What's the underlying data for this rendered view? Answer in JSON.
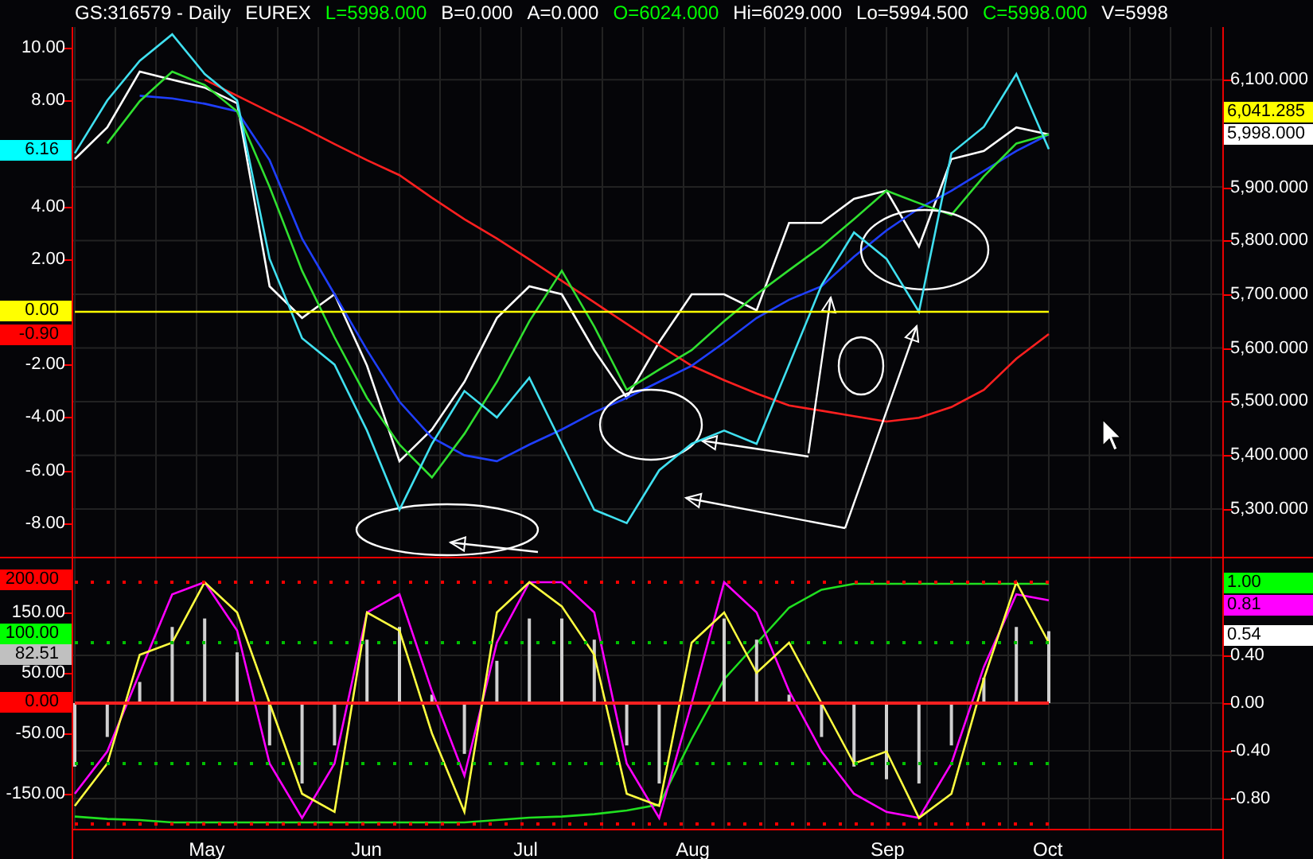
{
  "header": [
    {
      "text": "GS:316579 - Daily",
      "color": "#ffffff"
    },
    {
      "text": "EUREX",
      "color": "#ffffff"
    },
    {
      "text": "L=5998.000",
      "color": "#00ff00"
    },
    {
      "text": "B=0.000",
      "color": "#ffffff"
    },
    {
      "text": "A=0.000",
      "color": "#ffffff"
    },
    {
      "text": "O=6024.000",
      "color": "#00ff00"
    },
    {
      "text": "Hi=6029.000",
      "color": "#ffffff"
    },
    {
      "text": "Lo=5994.500",
      "color": "#ffffff"
    },
    {
      "text": "C=5998.000",
      "color": "#00ff00"
    },
    {
      "text": "V=5998",
      "color": "#ffffff"
    }
  ],
  "main_panel": {
    "price_chart": {
      "chart_data": {
        "type": "line",
        "grid": true,
        "categories": [
          null,
          null,
          null,
          null,
          null,
          null,
          null,
          null,
          null,
          null,
          null,
          null,
          null,
          null,
          null,
          null,
          null,
          null,
          null,
          null,
          null,
          null,
          null,
          null,
          null,
          null,
          null,
          null,
          null,
          null,
          null
        ],
        "ylim": [
          5211,
          6198
        ],
        "yticks": [
          {
            "value": 6100,
            "label": "6,100.000"
          },
          {
            "value": 5900,
            "label": "5,900.000"
          },
          {
            "value": 5800,
            "label": "5,800.000"
          },
          {
            "value": 5700,
            "label": "5,700.000"
          },
          {
            "value": 5600,
            "label": "5,600.000"
          },
          {
            "value": 5500,
            "label": "5,500.000"
          },
          {
            "value": 5400,
            "label": "5,400.000"
          },
          {
            "value": 5300,
            "label": "5,300.000"
          }
        ],
        "series": [
          {
            "color": "#ffffff",
            "values": [
              5952,
              6011,
              6115,
              6100,
              6085,
              6056,
              5715,
              5656,
              5700,
              5567,
              5389,
              5448,
              5537,
              5656,
              5715,
              5700,
              5596,
              5507,
              5611,
              5700,
              5700,
              5670,
              5833,
              5833,
              5878,
              5893,
              5789,
              5952,
              5967,
              6011,
              5998
            ]
          },
          {
            "color": "#ff2020",
            "values": [
              null,
              null,
              null,
              null,
              6100,
              6070,
              6040,
              6011,
              5980,
              5950,
              5922,
              5880,
              5840,
              5804,
              5765,
              5725,
              5685,
              5645,
              5605,
              5567,
              5540,
              5515,
              5493,
              5483,
              5473,
              5463,
              5470,
              5490,
              5522,
              5580,
              5626
            ]
          },
          {
            "color": "#1f3fff",
            "values": [
              null,
              null,
              6070,
              6065,
              6055,
              6041,
              5950,
              5804,
              5700,
              5596,
              5500,
              5433,
              5400,
              5389,
              5420,
              5448,
              5480,
              5507,
              5537,
              5567,
              5610,
              5656,
              5690,
              5715,
              5770,
              5819,
              5860,
              5893,
              5930,
              5967,
              5998
            ]
          },
          {
            "color": "#30e030",
            "values": [
              null,
              5981,
              6060,
              6115,
              6090,
              6041,
              5900,
              5744,
              5620,
              5507,
              5420,
              5359,
              5440,
              5537,
              5650,
              5744,
              5640,
              5522,
              5560,
              5596,
              5650,
              5700,
              5745,
              5789,
              5840,
              5893,
              5870,
              5848,
              5920,
              5981,
              5998
            ]
          }
        ]
      }
    },
    "oscillator_chart": {
      "chart_data": {
        "type": "line",
        "categories": [
          null,
          null,
          null,
          null,
          null,
          null,
          null,
          null,
          null,
          null,
          null,
          null,
          null,
          null,
          null,
          null,
          null,
          null,
          null,
          null,
          null,
          null,
          null,
          null,
          null,
          null,
          null,
          null,
          null,
          null,
          null
        ],
        "ylim": [
          -9.28,
          10.78
        ],
        "yticks": [
          {
            "value": 10,
            "label": "10.00"
          },
          {
            "value": 8,
            "label": "8.00"
          },
          {
            "value": 4,
            "label": "4.00"
          },
          {
            "value": 2,
            "label": "2.00"
          },
          {
            "value": -2,
            "label": "-2.00"
          },
          {
            "value": -4,
            "label": "-4.00"
          },
          {
            "value": -6,
            "label": "-6.00"
          },
          {
            "value": -8,
            "label": "-8.00"
          }
        ],
        "series": [
          {
            "color": "#40e0f0",
            "values": [
              6,
              8,
              9.5,
              10.5,
              9,
              8,
              2,
              -1,
              -2,
              -4.5,
              -7.5,
              -5,
              -3,
              -4,
              -2.5,
              -5,
              -7.5,
              -8,
              -6,
              -5,
              -4.5,
              -5,
              -2,
              1,
              3,
              2,
              0,
              6,
              7,
              9,
              6.16
            ]
          },
          {
            "color": "#ffff00",
            "values": [
              0,
              0,
              0,
              0,
              0,
              0,
              0,
              0,
              0,
              0,
              0,
              0,
              0,
              0,
              0,
              0,
              0,
              0,
              0,
              0,
              0,
              0,
              0,
              0,
              0,
              0,
              0,
              0,
              0,
              0,
              0
            ]
          }
        ]
      }
    },
    "left_tags": [
      {
        "text": "6.16",
        "color": "#00ffff"
      },
      {
        "text": "0.00",
        "color": "#ffff00"
      },
      {
        "text": "-0.90",
        "color": "#ff0000"
      }
    ],
    "right_tags": [
      {
        "text": "6,041.285",
        "color": "#ffff00"
      },
      {
        "text": "5,998.000",
        "color": "#ffffff"
      }
    ]
  },
  "lower_panel": {
    "trend_chart": {
      "chart_data": {
        "type": "line",
        "grid": true,
        "categories": [
          null,
          null,
          null,
          null,
          null,
          null,
          null,
          null,
          null,
          null,
          null,
          null,
          null,
          null,
          null,
          null,
          null,
          null,
          null,
          null,
          null,
          null,
          null,
          null,
          null,
          null,
          null,
          null,
          null,
          null,
          null
        ],
        "ylim": [
          -1.053,
          1.213
        ],
        "yticks": [
          {
            "value": 0.4,
            "label": "0.40"
          },
          {
            "value": 0,
            "label": "0.00"
          },
          {
            "value": -0.4,
            "label": "-0.40"
          },
          {
            "value": -0.8,
            "label": "-0.80"
          }
        ],
        "series": [
          {
            "color": "#20e020",
            "values": [
              -0.95,
              -0.97,
              -0.98,
              -1,
              -1,
              -1,
              -1,
              -1,
              -1,
              -1,
              -1,
              -1,
              -1,
              -0.98,
              -0.96,
              -0.95,
              -0.93,
              -0.9,
              -0.85,
              -0.3,
              0.2,
              0.5,
              0.8,
              0.95,
              1,
              1,
              1,
              1,
              1,
              1,
              1
            ]
          }
        ]
      }
    },
    "stochastic_chart": {
      "chart_data": {
        "type": "line",
        "categories": [
          null,
          null,
          null,
          null,
          "May",
          null,
          null,
          null,
          null,
          "Jun",
          null,
          null,
          null,
          null,
          "Jul",
          null,
          null,
          null,
          null,
          "Aug",
          null,
          null,
          null,
          null,
          null,
          "Sep",
          null,
          null,
          null,
          null,
          "Oct"
        ],
        "ylim": [
          -207.9,
          239.5
        ],
        "yticks": [
          {
            "value": 150,
            "label": "150.00"
          },
          {
            "value": 50,
            "label": "50.00"
          },
          {
            "value": -50,
            "label": "-50.00"
          },
          {
            "value": -150,
            "label": "-150.00"
          }
        ],
        "series": [
          {
            "color": "#ff00ff",
            "values": [
              -150,
              -80,
              50,
              180,
              200,
              120,
              -100,
              -190,
              -100,
              150,
              180,
              20,
              -120,
              100,
              200,
              200,
              150,
              -100,
              -190,
              0,
              200,
              150,
              20,
              -80,
              -150,
              -180,
              -190,
              -100,
              60,
              180,
              170
            ]
          },
          {
            "color": "#ffff40",
            "values": [
              -170,
              -100,
              80,
              100,
              200,
              150,
              0,
              -150,
              -180,
              150,
              120,
              -50,
              -180,
              150,
              200,
              160,
              80,
              -150,
              -170,
              100,
              150,
              50,
              100,
              0,
              -100,
              -80,
              -190,
              -150,
              40,
              200,
              100
            ]
          },
          {
            "color": "#ff0000",
            "line_style": "dotted",
            "values": [
              200,
              200,
              200,
              200,
              200,
              200,
              200,
              200,
              200,
              200,
              200,
              200,
              200,
              200,
              200,
              200,
              200,
              200,
              200,
              200,
              200,
              200,
              200,
              200,
              200,
              200,
              200,
              200,
              200,
              200,
              200
            ]
          },
          {
            "color": "#00c000",
            "line_style": "dotted",
            "values": [
              100,
              100,
              100,
              100,
              100,
              100,
              100,
              100,
              100,
              100,
              100,
              100,
              100,
              100,
              100,
              100,
              100,
              100,
              100,
              100,
              100,
              100,
              100,
              100,
              100,
              100,
              100,
              100,
              100,
              100,
              100
            ]
          },
          {
            "color": "#ff2020",
            "values": [
              0,
              0,
              0,
              0,
              0,
              0,
              0,
              0,
              0,
              0,
              0,
              0,
              0,
              0,
              0,
              0,
              0,
              0,
              0,
              0,
              0,
              0,
              0,
              0,
              0,
              0,
              0,
              0,
              0,
              0,
              0
            ]
          },
          {
            "color": "#00c000",
            "line_style": "dotted",
            "values": [
              -100,
              -100,
              -100,
              -100,
              -100,
              -100,
              -100,
              -100,
              -100,
              -100,
              -100,
              -100,
              -100,
              -100,
              -100,
              -100,
              -100,
              -100,
              -100,
              -100,
              -100,
              -100,
              -100,
              -100,
              -100,
              -100,
              -100,
              -100,
              -100,
              -100,
              -100
            ]
          },
          {
            "color": "#ff0000",
            "line_style": "dotted",
            "values": [
              -200,
              -200,
              -200,
              -200,
              -200,
              -200,
              -200,
              -200,
              -200,
              -200,
              -200,
              -200,
              -200,
              -200,
              -200,
              -200,
              -200,
              -200,
              -200,
              -200,
              -200,
              -200,
              -200,
              -200,
              -200,
              -200,
              -200,
              -200,
              -200,
              -200,
              -200
            ]
          }
        ]
      }
    },
    "left_tags": [
      {
        "text": "200.00",
        "color": "#ff0000"
      },
      {
        "text": "100.00",
        "color": "#00ff00"
      },
      {
        "text": "82.51",
        "color": "#c0c0c0"
      },
      {
        "text": "0.00",
        "color": "#ff0000"
      }
    ],
    "right_tags": [
      {
        "text": "1.00",
        "color": "#00ff00"
      },
      {
        "text": "0.81",
        "color": "#ff00ff"
      },
      {
        "text": "0.54",
        "color": "#ffffff"
      }
    ]
  }
}
